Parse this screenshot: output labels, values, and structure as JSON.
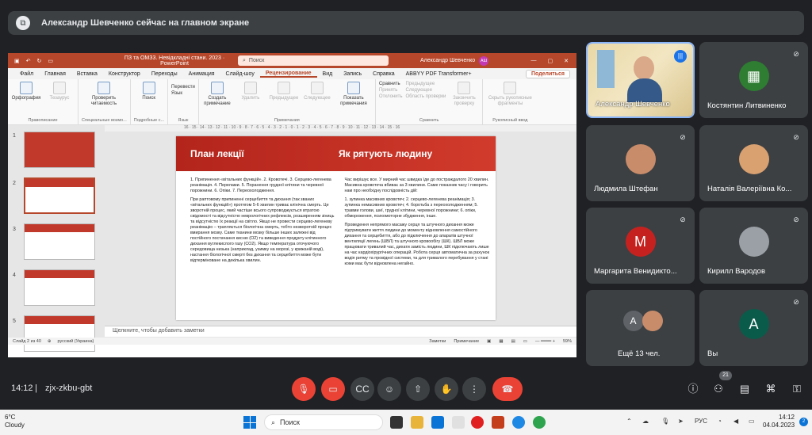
{
  "banner": {
    "text": "Александр Шевченко сейчас на главном экране"
  },
  "ppt": {
    "doc_title": "ПЗ та ОМЗ3. Невідкладні стани. 2023 · PowerPoint",
    "search_placeholder": "Поиск",
    "user_name": "Александр Шевченко",
    "user_initials": "АШ",
    "menu": [
      "Файл",
      "Главная",
      "Вставка",
      "Конструктор",
      "Переходы",
      "Анимация",
      "Слайд-шоу",
      "Рецензирование",
      "Вид",
      "Запись",
      "Справка",
      "ABBYY PDF Transformer+"
    ],
    "active_menu": "Рецензирование",
    "share": "Поделиться",
    "ribbon": {
      "spelling": "Орфография",
      "thesaurus": "Тезаурус",
      "check_access": "Проверить читаемость",
      "search": "Поиск",
      "translate": "Перевести",
      "language": "Язык",
      "new_comment": "Создать примечание",
      "delete": "Удалить",
      "previous": "Предыдущее",
      "next": "Следующее",
      "show_comments": "Показать примечания",
      "compare": "Сравнить",
      "accept": "Принять",
      "reject": "Отклонить",
      "prev_change": "Предыдущее",
      "next_change": "Следующее",
      "review_pane": "Область проверки",
      "end_review": "Закончить проверку",
      "ink": "Скрыть рукописные фрагменты",
      "groups": [
        "Правописание",
        "Специальные возмо...",
        "Подробные с...",
        "Язык",
        "Примечания",
        "Сравнить",
        "Рукописный ввод"
      ]
    },
    "ruler": "16 · 15 · 14 · 13 · 12 · 11 · 10 · 9 · 8 · 7 · 6 · 5 · 4 · 3 · 2 · 1 · 0 · 1 · 2 · 3 · 4 · 5 · 6 · 7 · 8 · 9 · 10 · 11 · 12 · 13 · 14 · 15 · 16",
    "thumb_numbers": [
      "1",
      "2",
      "3",
      "4",
      "5"
    ],
    "slide": {
      "title_left": "План лекції",
      "title_right": "Як рятують людину",
      "left_list": "1. Припинення «вітальних функцій». 2. Кровотечі. 3. Серцево-легенева реанімація. 4. Перелами. 5. Поранення грудної клітини та черевної порожнини. 6. Опіки. 7. Переохолодження.",
      "left_p1": "При раптовому припиненні серцебиття та дихання (так званих «вітальних функцій») протягом 5-6 хвилин триває клінічна смерть. Це зворотній процес, який частіше всього супроводжується втратою свідомості та відсутністю неврологічних рефлексів, розширенням зіниць та відсутністю їх реакції на світло. Якщо не провести серцево-легеневу реанімацію – трапляється біологічна смерть, тобто незворотній процес вмирання мозку. Саме тканини мозку більше інших залежні від постійного постачання кисню (О2) та виведення продукту клітинного дихання вуглекислого газу (СО2). Якщо температура оточуючого середовища низька (наприклад, узимку на морозі, у крижаній воді), настання біологічної смерті без дихання та серцебиття може бути відтерміноване на декілька хвилин.",
      "right_p1": "Час вирішує все. У мирний час швидка їде до постраждалого 20 хвилин. Масивна кровотеча вбиває за 3 хвилини. Саме показник часу і говорить нам про необхідну послідовність дій:",
      "right_list": "1. зупинка масивних кровотеч; 2. серцево-легенева реанімація; 3. зупинка немасивних кровотеч; 4. боротьба з переохолодженням; 5. травми голови, шиї, грудної клітини, черевної порожнини; 6. опіки, обмороження, психомоторне збудження, інше.",
      "right_p2": "Проведення непрямого масажу серця та штучного дихання може підтримувати життя людини до моменту відновлення самостійного дихання та серцебиття, або до підключення до апаратів штучної вентиляції легень (ШВЛ) та штучного кровообігу (ШК). ШВЛ може працювати тривалий час, дихати замість людини, ШК підключають лише на час кардіохірургічних операцій. Робота серця автоматична за рахунок водія ритму та провідної системи, та для тривалого перебування у стані коми має бути відновлена негайно."
    },
    "notes_placeholder": "Щелкните, чтобы добавить заметки",
    "status": {
      "slide_info": "Слайд 2 из 40",
      "language": "русский (Украина)",
      "notes": "Заметки",
      "comments": "Примечание",
      "zoom": "59%"
    }
  },
  "participants": [
    {
      "name": "Александр Шевченко",
      "type": "camera",
      "speaking": true
    },
    {
      "name": "Костянтин Литвиненко",
      "type": "avatar",
      "initial": "",
      "color": "#2e7d32",
      "muted": true
    },
    {
      "name": "Людмила Штефан",
      "type": "photo",
      "color": "#c98c6a",
      "muted": true
    },
    {
      "name": "Наталія Валеріївна Ко...",
      "type": "photo",
      "color": "#d9a070",
      "muted": true
    },
    {
      "name": "Маргарита Венидикто...",
      "type": "avatar",
      "initial": "М",
      "color": "#c5221f",
      "muted": true
    },
    {
      "name": "Кирилл Вародов",
      "type": "photo",
      "color": "#9aa0a6",
      "muted": true
    },
    {
      "name": "Ещё 13 чел.",
      "type": "group",
      "initial": "А",
      "muted": true
    },
    {
      "name": "Вы",
      "type": "avatar",
      "initial": "A",
      "color": "#0b5b4b",
      "muted": true
    }
  ],
  "meet": {
    "time": "14:12",
    "separator": "|",
    "code": "zjx-zkbu-gbt",
    "participant_count": "21"
  },
  "taskbar": {
    "temp": "6°C",
    "weather": "Cloudy",
    "search": "Поиск",
    "lang": "РУС",
    "time": "14:12",
    "date": "04.04.2023",
    "notif_count": "2"
  }
}
